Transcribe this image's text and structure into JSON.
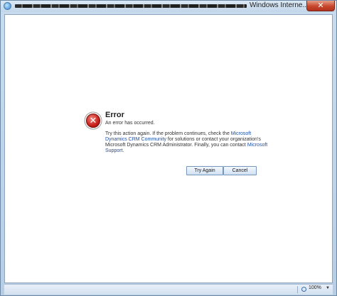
{
  "window": {
    "title": "Windows Interne...",
    "close_symbol": "✕"
  },
  "error": {
    "icon_symbol": "✕",
    "title": "Error",
    "subtitle": "An error has occurred.",
    "message_part1": "Try this action again. If the problem continues, check the ",
    "link_community": "Microsoft Dynamics CRM Community",
    "message_part2": " for solutions or contact your organization's Microsoft Dynamics CRM Administrator. Finally, you can contact ",
    "link_support": "Microsoft Support",
    "message_part3": "."
  },
  "buttons": {
    "try_again": "Try Again",
    "cancel": "Cancel"
  },
  "statusbar": {
    "zoom": "100%",
    "zoom_dropdown": "▼"
  },
  "icons": {
    "browser": "ie-icon",
    "error": "error-icon",
    "zoom": "zoom-icon"
  },
  "colors": {
    "error_red": "#c9201a",
    "link_blue": "#1b4fa8",
    "chrome_blue": "#c9dcee"
  }
}
